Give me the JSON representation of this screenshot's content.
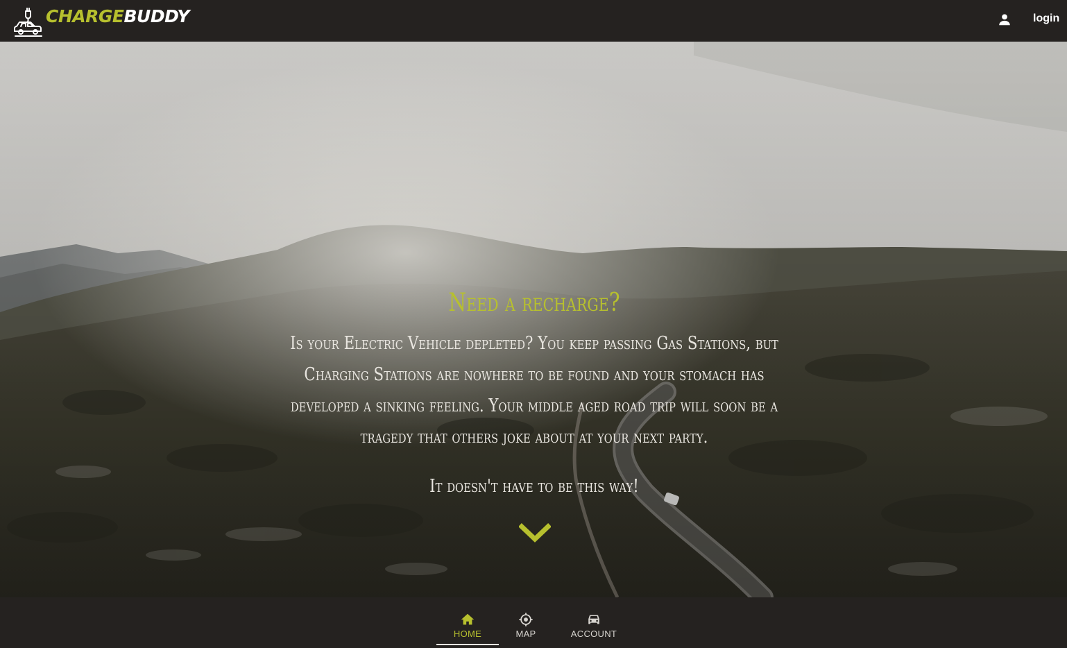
{
  "header": {
    "logo_charge": "CHARGE",
    "logo_buddy": "BUDDY",
    "login_label": "login"
  },
  "hero": {
    "title": "Need a recharge?",
    "body": "Is your Electric Vehicle depleted? You keep passing Gas Stations, but Charging Stations are nowhere to be found and your stomach has developed a sinking feeling. Your middle aged road trip will soon be a tragedy that others joke about at your next party.",
    "tagline": "It doesn't have to be this way!"
  },
  "nav": {
    "items": [
      {
        "label": "HOME",
        "icon": "home-icon",
        "active": true
      },
      {
        "label": "MAP",
        "icon": "crosshair-icon",
        "active": false
      },
      {
        "label": "ACCOUNT",
        "icon": "car-icon",
        "active": false
      }
    ]
  },
  "colors": {
    "accent": "#b7c02e",
    "bar_background": "#252220",
    "text_light": "#e9e6e0"
  }
}
